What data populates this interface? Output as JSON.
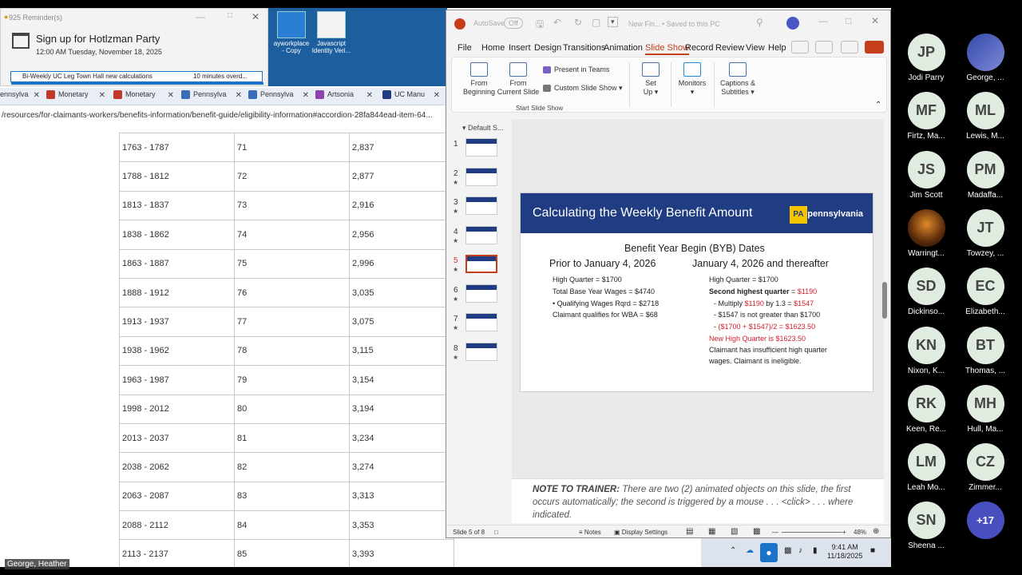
{
  "reminder": {
    "window_title": "925 Reminder(s)",
    "heading": "Sign up for Hotlzman Party",
    "time": "12:00 AM Tuesday, November 18, 2025",
    "item_title": "Bi-Weekly UC Leg Town Hall new calculations",
    "item_due": "10 minutes overd..."
  },
  "desktop_icons": [
    {
      "line1": "Imagine",
      "line2": "ayworkplace",
      "line3": "- Copy"
    },
    {
      "line1": "",
      "line2": "Javascript",
      "line3": "Identity Veri..."
    }
  ],
  "browser": {
    "tabs": [
      {
        "label": "ennsylva",
        "color": "#3a6db7"
      },
      {
        "label": "Monetary",
        "color": "#c0392b"
      },
      {
        "label": "Monetary",
        "color": "#c0392b"
      },
      {
        "label": "Pennsylva",
        "color": "#3a6db7"
      },
      {
        "label": "Pennsylva",
        "color": "#3a6db7"
      },
      {
        "label": "Artsonia",
        "color": "#8e44ad"
      },
      {
        "label": "UC Manu",
        "color": "#203c82"
      }
    ],
    "url": "/resources/for-claimants-workers/benefits-information/benefit-guide/eligibility-information#accordion-28fa844ead-item-64..."
  },
  "benefit_table": [
    [
      "1763 - 1787",
      "71",
      "2,837"
    ],
    [
      "1788 - 1812",
      "72",
      "2,877"
    ],
    [
      "1813 - 1837",
      "73",
      "2,916"
    ],
    [
      "1838 - 1862",
      "74",
      "2,956"
    ],
    [
      "1863 - 1887",
      "75",
      "2,996"
    ],
    [
      "1888 - 1912",
      "76",
      "3,035"
    ],
    [
      "1913 - 1937",
      "77",
      "3,075"
    ],
    [
      "1938 - 1962",
      "78",
      "3,115"
    ],
    [
      "1963 - 1987",
      "79",
      "3,154"
    ],
    [
      "1998 - 2012",
      "80",
      "3,194"
    ],
    [
      "2013 - 2037",
      "81",
      "3,234"
    ],
    [
      "2038 - 2062",
      "82",
      "3,274"
    ],
    [
      "2063 - 2087",
      "83",
      "3,313"
    ],
    [
      "2088 - 2112",
      "84",
      "3,353"
    ],
    [
      "2113 - 2137",
      "85",
      "3,393"
    ]
  ],
  "ppt": {
    "autosave_label": "AutoSave",
    "autosave_state": "Off",
    "file_title": "New Fin...",
    "save_status": "Saved to this PC",
    "menu": [
      "File",
      "Home",
      "Insert",
      "Design",
      "Transitions",
      "Animation",
      "Slide Show",
      "Record",
      "Review",
      "View",
      "Help"
    ],
    "active_menu_index": 6,
    "ribbon": {
      "from_beginning": [
        "From",
        "Beginning"
      ],
      "from_current": [
        "From",
        "Current Slide"
      ],
      "present_in_teams": "Present in Teams",
      "custom_slide_show": "Custom Slide Show",
      "set_up": [
        "Set",
        "Up"
      ],
      "monitors": "Monitors",
      "captions": [
        "Captions &",
        "Subtitles"
      ],
      "group_label": "Start Slide Show"
    },
    "section_label": "Default S...",
    "slide_numbers": [
      "1",
      "2",
      "3",
      "4",
      "5",
      "6",
      "7",
      "8"
    ],
    "current_slide_index": 4,
    "slide": {
      "title": "Calculating the Weekly Benefit Amount",
      "logo_mark": "PA",
      "logo_text": "pennsylvania",
      "subtitle": "Benefit Year Begin (BYB) Dates",
      "left_heading": "Prior to January 4, 2026",
      "right_heading": "January 4, 2026 and thereafter",
      "left_lines": [
        "High Quarter = $1700",
        "Total Base Year Wages = $4740",
        "• Qualifying Wages Rqrd = $2718",
        "Claimant qualifies for WBA = $68"
      ],
      "right": {
        "hq": "High Quarter = $1700",
        "second_label": "Second highest quarter",
        "second_eq": " = ",
        "second_val": "$1190",
        "multiply_pre": "- Multiply ",
        "multiply_a": "$1190",
        "multiply_mid": " by 1.3 = ",
        "multiply_b": "$1547",
        "not_greater": "- $1547 is not greater than $1700",
        "avg_dash": "- ",
        "avg": "($1700 + $1547)/2 = $1623.50",
        "new_hq": "New High Quarter is $1623.50",
        "ineligible_1": "Claimant has insufficient high quarter",
        "ineligible_2": "wages. Claimant is ineligible."
      }
    },
    "notes": {
      "label": "NOTE TO TRAINER:",
      "text": " There are two (2) animated objects on this slide, the first occurs automatically; the second is triggered by a mouse  . . . <click> . . . where indicated."
    },
    "status": {
      "slide_count": "Slide 5 of 8",
      "notes_btn": "Notes",
      "display_settings": "Display Settings",
      "zoom": "48%"
    }
  },
  "taskbar": {
    "time": "9:41 AM",
    "date": "11/18/2025"
  },
  "presenter_name": "George, Heather",
  "participants": [
    {
      "initials": "JP",
      "name": "Jodi Parry"
    },
    {
      "initials": "",
      "name": "George, ..."
    },
    {
      "initials": "MF",
      "name": "Firtz, Ma..."
    },
    {
      "initials": "ML",
      "name": "Lewis, M..."
    },
    {
      "initials": "JS",
      "name": "Jim Scott"
    },
    {
      "initials": "PM",
      "name": "Madaffa..."
    },
    {
      "initials": "",
      "name": "Warringt..."
    },
    {
      "initials": "JT",
      "name": "Towzey, ..."
    },
    {
      "initials": "SD",
      "name": "Dickinso..."
    },
    {
      "initials": "EC",
      "name": "Elizabeth..."
    },
    {
      "initials": "KN",
      "name": "Nixon, K..."
    },
    {
      "initials": "BT",
      "name": "Thomas, ..."
    },
    {
      "initials": "RK",
      "name": "Keen, Re..."
    },
    {
      "initials": "MH",
      "name": "Hull, Ma..."
    },
    {
      "initials": "LM",
      "name": "Leah Mo..."
    },
    {
      "initials": "CZ",
      "name": "Zimmer..."
    },
    {
      "initials": "SN",
      "name": "Sheena ..."
    },
    {
      "initials": "+17",
      "name": ""
    }
  ]
}
